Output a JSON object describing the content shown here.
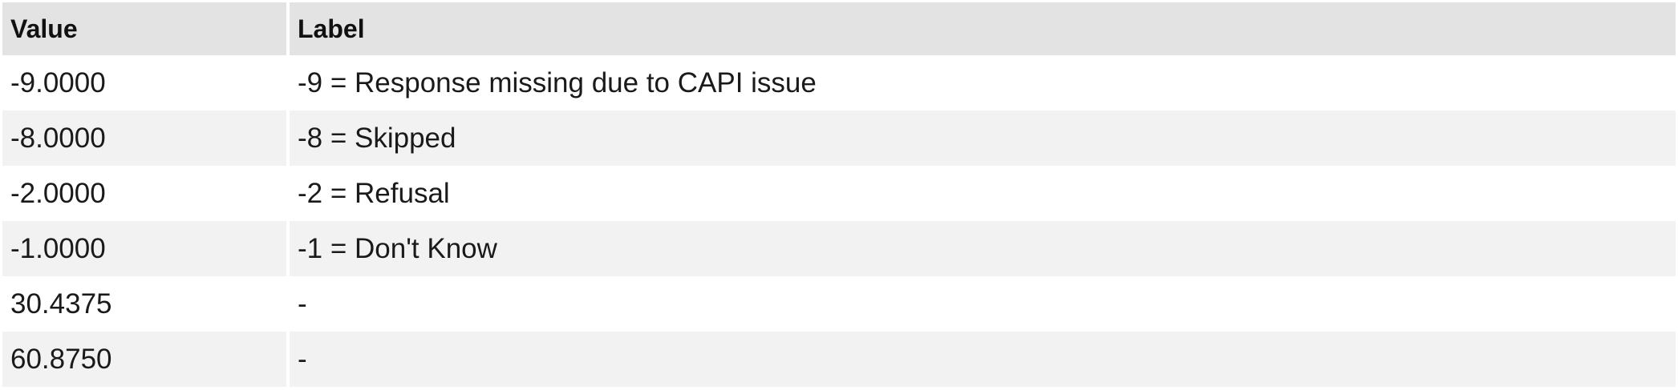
{
  "table": {
    "headers": {
      "value": "Value",
      "label": "Label"
    },
    "rows": [
      {
        "value": "-9.0000",
        "label": "-9 = Response missing due to CAPI issue"
      },
      {
        "value": "-8.0000",
        "label": "-8 = Skipped"
      },
      {
        "value": "-2.0000",
        "label": "-2 = Refusal"
      },
      {
        "value": "-1.0000",
        "label": "-1 = Don't Know"
      },
      {
        "value": "30.4375",
        "label": "-"
      },
      {
        "value": "60.8750",
        "label": "-"
      }
    ]
  }
}
